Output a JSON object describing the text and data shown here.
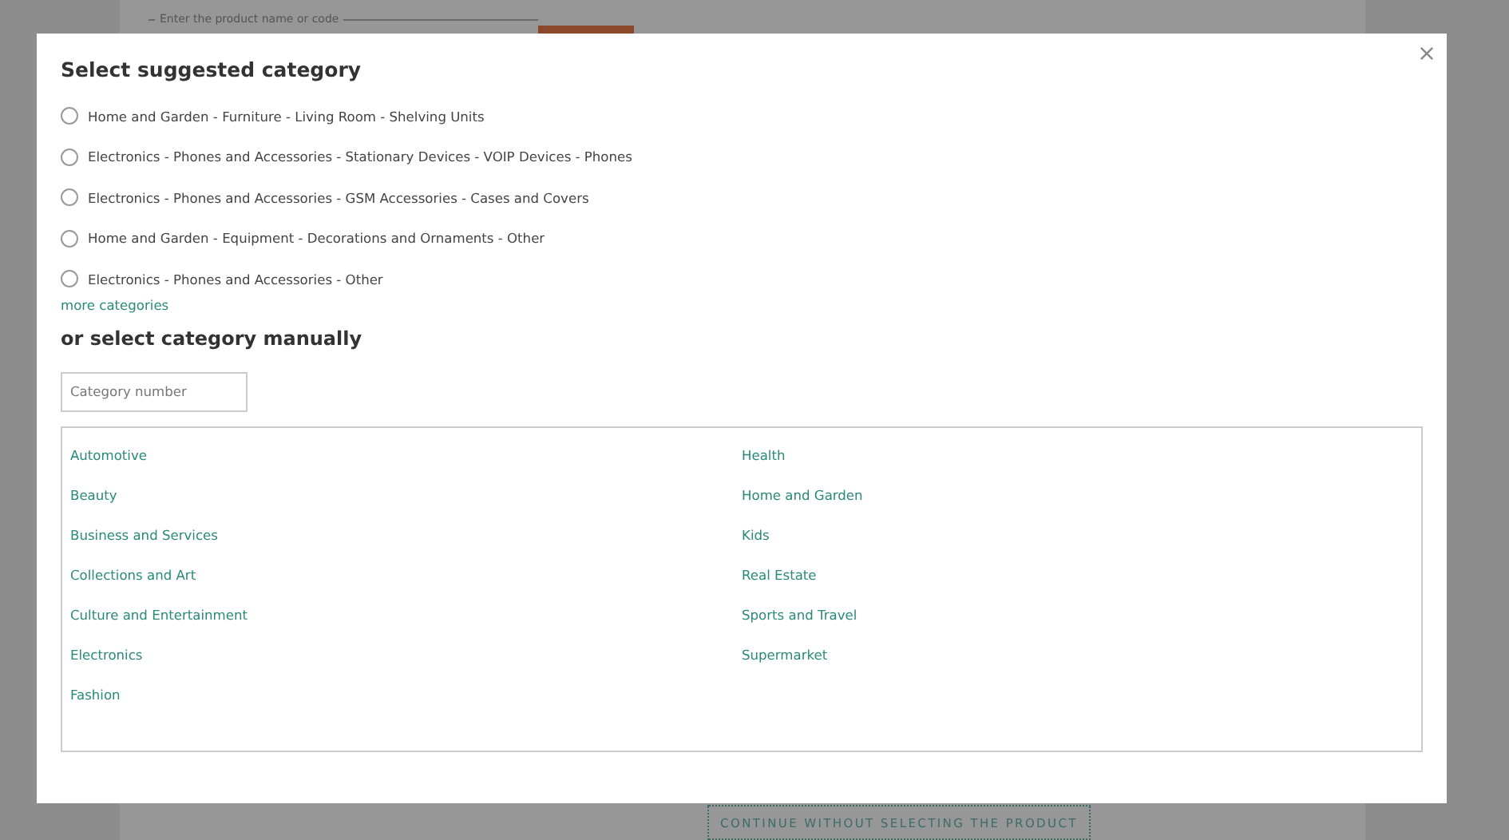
{
  "background_page": {
    "search_field": {
      "label": "Enter the product name or code"
    },
    "continue_button": "CONTINUE WITHOUT SELECTING THE PRODUCT"
  },
  "dialog": {
    "title": "Select suggested category",
    "suggested_categories": [
      {
        "label": "Home and Garden - Furniture - Living Room - Shelving Units",
        "selected": false
      },
      {
        "label": "Electronics - Phones and Accessories - Stationary Devices - VOIP Devices - Phones",
        "selected": false
      },
      {
        "label": "Electronics - Phones and Accessories - GSM Accessories - Cases and Covers",
        "selected": false
      },
      {
        "label": "Home and Garden - Equipment - Decorations and Ornaments - Other",
        "selected": false
      },
      {
        "label": "Electronics - Phones and Accessories - Other",
        "selected": false
      }
    ],
    "more_link": "more categories",
    "manual_title": "or select category manually",
    "category_field": {
      "placeholder": "Category number"
    },
    "categories": [
      "Automotive",
      "Beauty",
      "Business and Services",
      "Collections and Art",
      "Culture and Entertainment",
      "Electronics",
      "Fashion",
      "Health",
      "Home and Garden",
      "Kids",
      "Real Estate",
      "Sports and Travel",
      "Supermarket"
    ]
  }
}
